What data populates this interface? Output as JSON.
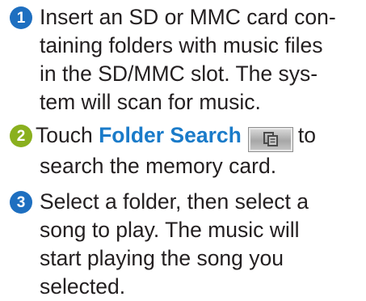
{
  "steps": [
    {
      "number": "1",
      "badge_color": "#1e6fc0",
      "lines": [
        "Insert an SD or MMC card con-",
        "taining folders with music files",
        "in the SD/MMC slot. The sys-",
        "tem will scan for music."
      ]
    },
    {
      "number": "2",
      "badge_color": "#8ab01e",
      "text_before": "Touch",
      "highlight": "Folder Search",
      "button_icon": "folder-search-icon",
      "text_after": "to",
      "line2": "search the memory card."
    },
    {
      "number": "3",
      "badge_color": "#1e6fc0",
      "lines": [
        "Select a folder, then select a",
        "song to play. The music will",
        "start playing the song you",
        "selected."
      ]
    }
  ]
}
